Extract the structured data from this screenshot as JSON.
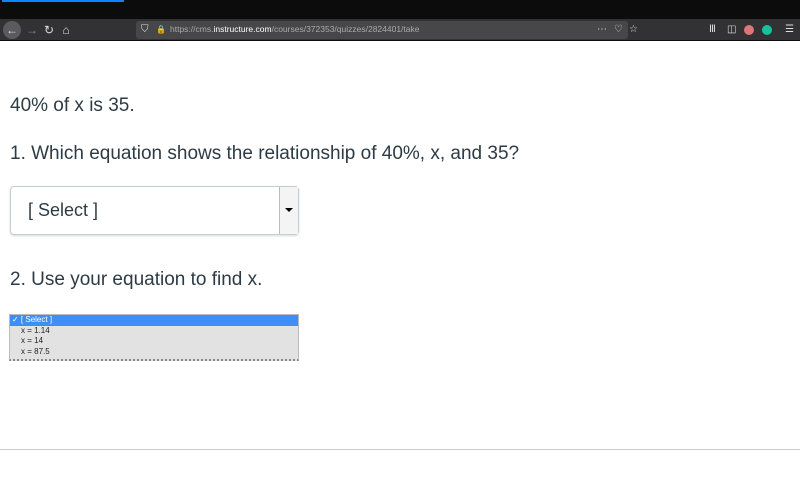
{
  "browser": {
    "url_prefix": "https://cms.",
    "url_domain": "instructure.com",
    "url_path": "/courses/372353/quizzes/2824401/take",
    "icons": [
      "back-icon",
      "forward-icon",
      "reload-icon",
      "home-icon",
      "shield-icon",
      "lock-icon",
      "more-icon",
      "pocket-icon",
      "star-icon",
      "library-icon",
      "sidebar-icon",
      "avatar-icon",
      "grammarly-icon",
      "menu-icon"
    ]
  },
  "quiz": {
    "prompt": "40% of x is 35.",
    "q1": "1. Which equation shows the relationship of 40%, x, and 35?",
    "q1_select": "[ Select ]",
    "q2": "2. Use your equation to find x.",
    "q2_options": [
      "✓ [ Select ]",
      "x = 1.14",
      "x = 14",
      "x = 87.5"
    ]
  },
  "colors": {
    "accent": "#3d8ff5",
    "text": "#2d3b45"
  }
}
